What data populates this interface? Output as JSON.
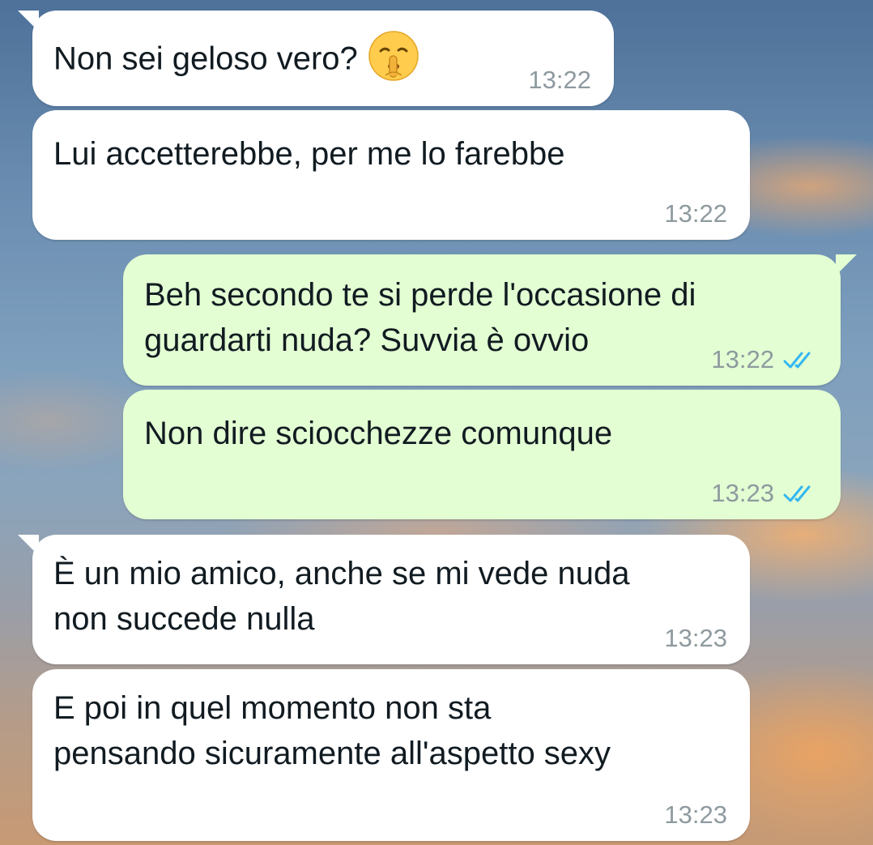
{
  "messages": [
    {
      "direction": "incoming",
      "text": "Non sei geloso vero?",
      "emoji": "shushing-face-emoji",
      "time": "13:22"
    },
    {
      "direction": "incoming",
      "text": "Lui accetterebbe, per me lo farebbe",
      "time": "13:22"
    },
    {
      "direction": "outgoing",
      "text": "Beh secondo te si perde l'occasione di\nguardarti nuda? Suvvia è ovvio",
      "time": "13:22",
      "status": "read"
    },
    {
      "direction": "outgoing",
      "text": "Non dire sciocchezze comunque",
      "time": "13:23",
      "status": "read"
    },
    {
      "direction": "incoming",
      "text": "È un mio amico, anche se mi vede nuda\nnon succede nulla",
      "time": "13:23"
    },
    {
      "direction": "incoming",
      "text": "E poi in quel momento non sta\npensando sicuramente all'aspetto sexy",
      "time": "13:23"
    }
  ],
  "colors": {
    "incoming_bubble": "#ffffff",
    "outgoing_bubble": "#e3fed3",
    "text": "#111b21",
    "timestamp": "#8e9a9f",
    "read_ticks": "#34b7f1"
  }
}
